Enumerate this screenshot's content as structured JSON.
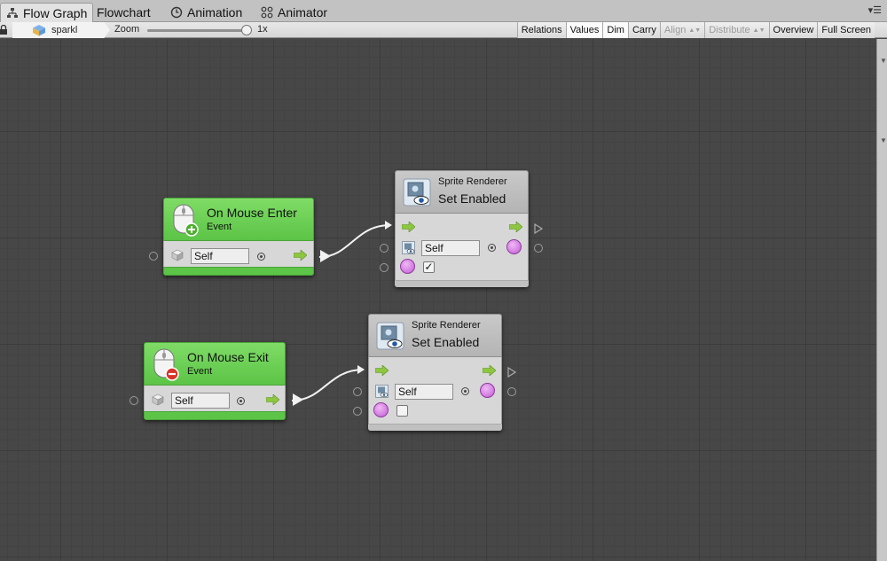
{
  "tabs": [
    {
      "label": "Flow Graph",
      "icon": "hierarchy-icon",
      "active": true
    },
    {
      "label": "Flowchart",
      "icon": "",
      "active": false
    },
    {
      "label": "Animation",
      "icon": "clock-icon",
      "active": false
    },
    {
      "label": "Animator",
      "icon": "animator-icon",
      "active": false
    }
  ],
  "toolbar": {
    "breadcrumb": "sparkl",
    "zoom_label": "Zoom",
    "zoom_value": "1x",
    "zoom_level": 1.0,
    "buttons": {
      "relations": "Relations",
      "values": "Values",
      "dim": "Dim",
      "carry": "Carry",
      "align": "Align",
      "distribute": "Distribute",
      "overview": "Overview",
      "full_screen": "Full Screen"
    }
  },
  "nodes": {
    "mouse_enter": {
      "title": "On Mouse Enter",
      "subtitle": "Event",
      "target_value": "Self"
    },
    "mouse_exit": {
      "title": "On Mouse Exit",
      "subtitle": "Event",
      "target_value": "Self"
    },
    "set_enabled_1": {
      "component": "Sprite Renderer",
      "title": "Set Enabled",
      "target_value": "Self",
      "enabled": true
    },
    "set_enabled_2": {
      "component": "Sprite Renderer",
      "title": "Set Enabled",
      "target_value": "Self",
      "enabled": false
    }
  },
  "colors": {
    "event_green": "#5cc447",
    "value_purple": "#c25bd3",
    "flow_arrow": "#8dc63f",
    "canvas": "#474747"
  }
}
